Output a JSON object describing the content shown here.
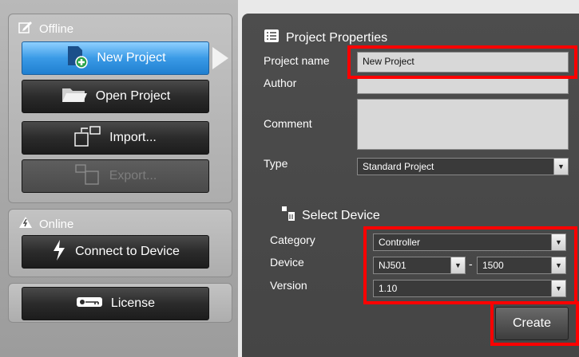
{
  "offline": {
    "title": "Offline",
    "new_project": "New Project",
    "open_project": "Open Project",
    "import": "Import...",
    "export": "Export..."
  },
  "online": {
    "title": "Online",
    "connect": "Connect to Device"
  },
  "license": {
    "label": "License"
  },
  "project_properties": {
    "title": "Project Properties",
    "project_name_label": "Project name",
    "project_name_value": "New Project",
    "author_label": "Author",
    "author_value": "",
    "comment_label": "Comment",
    "comment_value": "",
    "type_label": "Type",
    "type_value": "Standard Project"
  },
  "select_device": {
    "title": "Select Device",
    "category_label": "Category",
    "category_value": "Controller",
    "device_label": "Device",
    "device_value": "NJ501",
    "device_separator": "-",
    "device_model_value": "1500",
    "version_label": "Version",
    "version_value": "1.10"
  },
  "create_label": "Create",
  "colors": {
    "active_button": "#3a9ae6",
    "highlight": "#ff0000",
    "panel_bg": "#4d4d4d"
  }
}
